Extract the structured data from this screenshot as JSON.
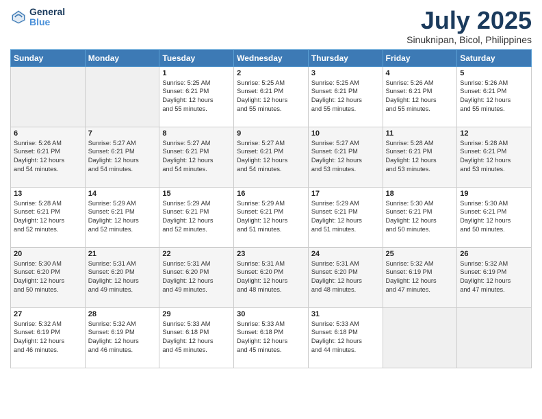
{
  "header": {
    "logo_line1": "General",
    "logo_line2": "Blue",
    "month": "July 2025",
    "location": "Sinuknipan, Bicol, Philippines"
  },
  "weekdays": [
    "Sunday",
    "Monday",
    "Tuesday",
    "Wednesday",
    "Thursday",
    "Friday",
    "Saturday"
  ],
  "weeks": [
    [
      {
        "day": "",
        "info": "",
        "empty": true
      },
      {
        "day": "",
        "info": "",
        "empty": true
      },
      {
        "day": "1",
        "info": "Sunrise: 5:25 AM\nSunset: 6:21 PM\nDaylight: 12 hours\nand 55 minutes."
      },
      {
        "day": "2",
        "info": "Sunrise: 5:25 AM\nSunset: 6:21 PM\nDaylight: 12 hours\nand 55 minutes."
      },
      {
        "day": "3",
        "info": "Sunrise: 5:25 AM\nSunset: 6:21 PM\nDaylight: 12 hours\nand 55 minutes."
      },
      {
        "day": "4",
        "info": "Sunrise: 5:26 AM\nSunset: 6:21 PM\nDaylight: 12 hours\nand 55 minutes."
      },
      {
        "day": "5",
        "info": "Sunrise: 5:26 AM\nSunset: 6:21 PM\nDaylight: 12 hours\nand 55 minutes."
      }
    ],
    [
      {
        "day": "6",
        "info": "Sunrise: 5:26 AM\nSunset: 6:21 PM\nDaylight: 12 hours\nand 54 minutes.",
        "gray": true
      },
      {
        "day": "7",
        "info": "Sunrise: 5:27 AM\nSunset: 6:21 PM\nDaylight: 12 hours\nand 54 minutes.",
        "gray": true
      },
      {
        "day": "8",
        "info": "Sunrise: 5:27 AM\nSunset: 6:21 PM\nDaylight: 12 hours\nand 54 minutes.",
        "gray": true
      },
      {
        "day": "9",
        "info": "Sunrise: 5:27 AM\nSunset: 6:21 PM\nDaylight: 12 hours\nand 54 minutes.",
        "gray": true
      },
      {
        "day": "10",
        "info": "Sunrise: 5:27 AM\nSunset: 6:21 PM\nDaylight: 12 hours\nand 53 minutes.",
        "gray": true
      },
      {
        "day": "11",
        "info": "Sunrise: 5:28 AM\nSunset: 6:21 PM\nDaylight: 12 hours\nand 53 minutes.",
        "gray": true
      },
      {
        "day": "12",
        "info": "Sunrise: 5:28 AM\nSunset: 6:21 PM\nDaylight: 12 hours\nand 53 minutes.",
        "gray": true
      }
    ],
    [
      {
        "day": "13",
        "info": "Sunrise: 5:28 AM\nSunset: 6:21 PM\nDaylight: 12 hours\nand 52 minutes."
      },
      {
        "day": "14",
        "info": "Sunrise: 5:29 AM\nSunset: 6:21 PM\nDaylight: 12 hours\nand 52 minutes."
      },
      {
        "day": "15",
        "info": "Sunrise: 5:29 AM\nSunset: 6:21 PM\nDaylight: 12 hours\nand 52 minutes."
      },
      {
        "day": "16",
        "info": "Sunrise: 5:29 AM\nSunset: 6:21 PM\nDaylight: 12 hours\nand 51 minutes."
      },
      {
        "day": "17",
        "info": "Sunrise: 5:29 AM\nSunset: 6:21 PM\nDaylight: 12 hours\nand 51 minutes."
      },
      {
        "day": "18",
        "info": "Sunrise: 5:30 AM\nSunset: 6:21 PM\nDaylight: 12 hours\nand 50 minutes."
      },
      {
        "day": "19",
        "info": "Sunrise: 5:30 AM\nSunset: 6:21 PM\nDaylight: 12 hours\nand 50 minutes."
      }
    ],
    [
      {
        "day": "20",
        "info": "Sunrise: 5:30 AM\nSunset: 6:20 PM\nDaylight: 12 hours\nand 50 minutes.",
        "gray": true
      },
      {
        "day": "21",
        "info": "Sunrise: 5:31 AM\nSunset: 6:20 PM\nDaylight: 12 hours\nand 49 minutes.",
        "gray": true
      },
      {
        "day": "22",
        "info": "Sunrise: 5:31 AM\nSunset: 6:20 PM\nDaylight: 12 hours\nand 49 minutes.",
        "gray": true
      },
      {
        "day": "23",
        "info": "Sunrise: 5:31 AM\nSunset: 6:20 PM\nDaylight: 12 hours\nand 48 minutes.",
        "gray": true
      },
      {
        "day": "24",
        "info": "Sunrise: 5:31 AM\nSunset: 6:20 PM\nDaylight: 12 hours\nand 48 minutes.",
        "gray": true
      },
      {
        "day": "25",
        "info": "Sunrise: 5:32 AM\nSunset: 6:19 PM\nDaylight: 12 hours\nand 47 minutes.",
        "gray": true
      },
      {
        "day": "26",
        "info": "Sunrise: 5:32 AM\nSunset: 6:19 PM\nDaylight: 12 hours\nand 47 minutes.",
        "gray": true
      }
    ],
    [
      {
        "day": "27",
        "info": "Sunrise: 5:32 AM\nSunset: 6:19 PM\nDaylight: 12 hours\nand 46 minutes."
      },
      {
        "day": "28",
        "info": "Sunrise: 5:32 AM\nSunset: 6:19 PM\nDaylight: 12 hours\nand 46 minutes."
      },
      {
        "day": "29",
        "info": "Sunrise: 5:33 AM\nSunset: 6:18 PM\nDaylight: 12 hours\nand 45 minutes."
      },
      {
        "day": "30",
        "info": "Sunrise: 5:33 AM\nSunset: 6:18 PM\nDaylight: 12 hours\nand 45 minutes."
      },
      {
        "day": "31",
        "info": "Sunrise: 5:33 AM\nSunset: 6:18 PM\nDaylight: 12 hours\nand 44 minutes."
      },
      {
        "day": "",
        "info": "",
        "empty": true
      },
      {
        "day": "",
        "info": "",
        "empty": true
      }
    ]
  ]
}
